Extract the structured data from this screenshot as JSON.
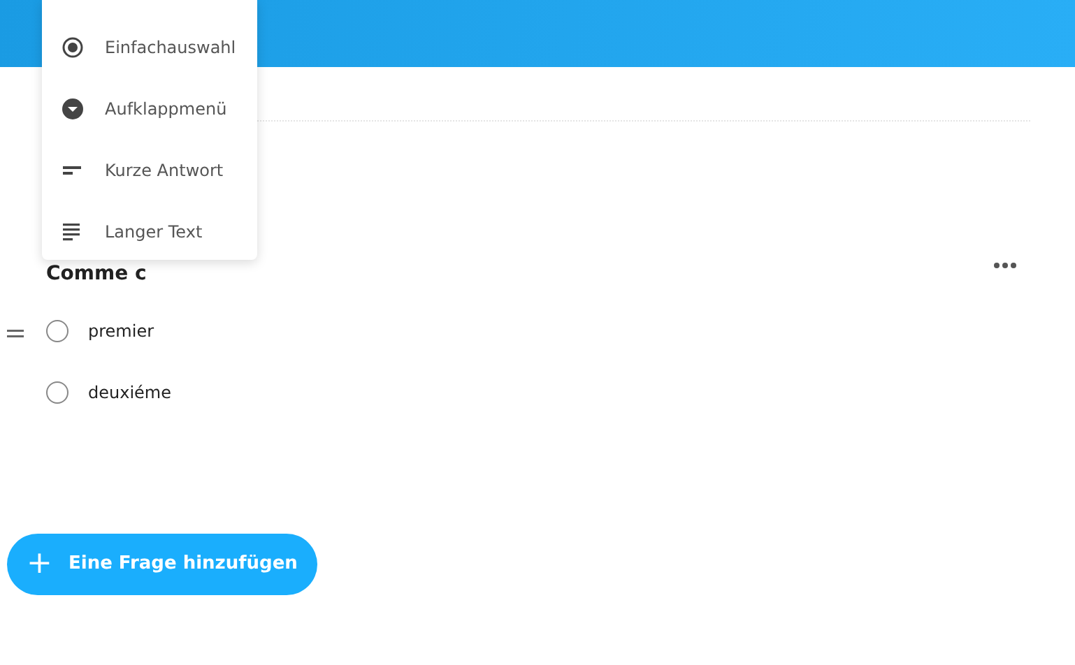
{
  "menu": [
    {
      "kind": "radio",
      "label": "Einfachauswahl"
    },
    {
      "kind": "dropdown",
      "label": "Aufklappmenü"
    },
    {
      "kind": "short",
      "label": "Kurze Antwort"
    },
    {
      "kind": "long",
      "label": "Langer Text"
    }
  ],
  "question": {
    "title": "Comme c",
    "options": [
      {
        "label": "premier",
        "checked": false
      },
      {
        "label": "deuxiéme",
        "checked": false
      }
    ]
  },
  "add_button": {
    "icon": "+",
    "label": "Eine Frage hinzufügen"
  }
}
